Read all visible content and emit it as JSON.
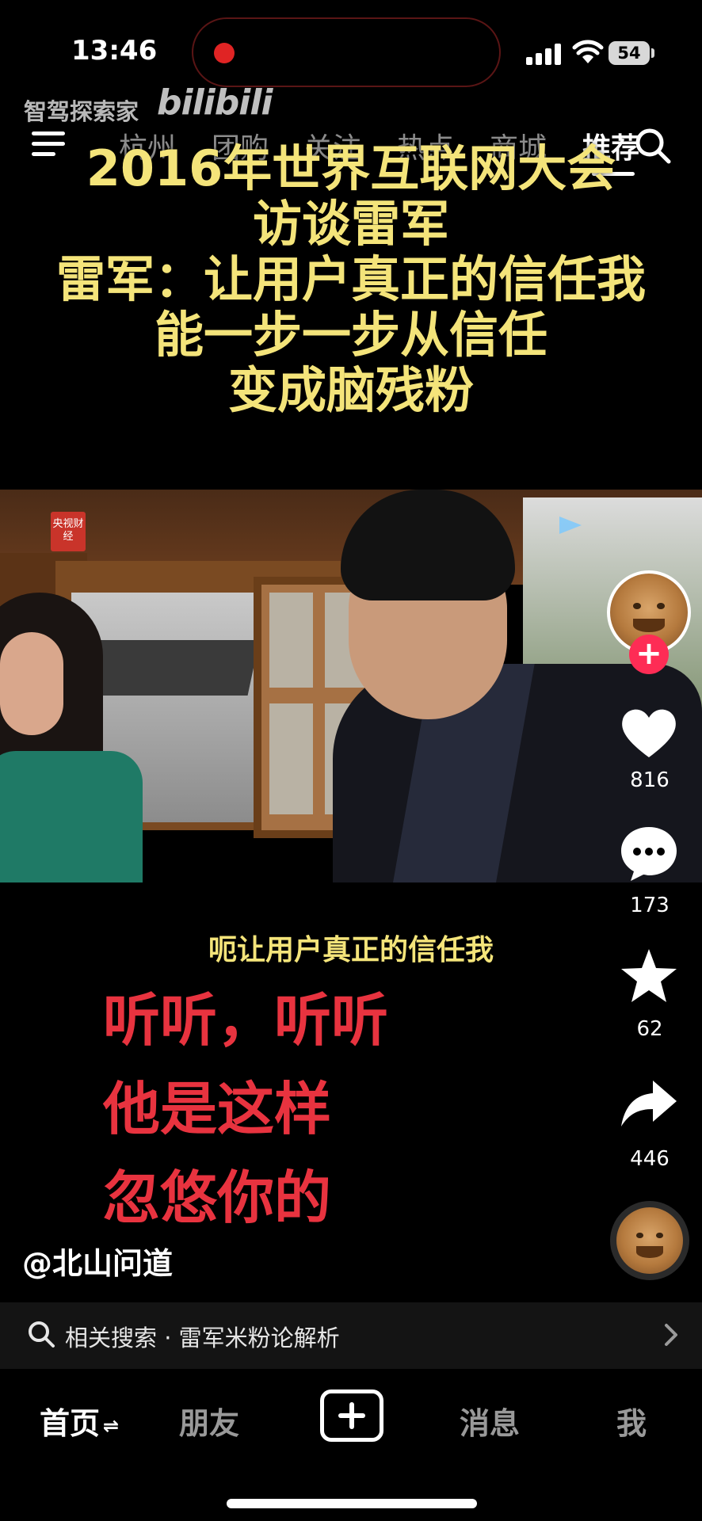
{
  "status_bar": {
    "time": "13:46",
    "battery": "54"
  },
  "watermark": {
    "channel": "智驾探索家",
    "site": "bilibili"
  },
  "top_nav": {
    "tabs": [
      {
        "label": "杭州"
      },
      {
        "label": "团购"
      },
      {
        "label": "关注"
      },
      {
        "label": "热点"
      },
      {
        "label": "商城"
      },
      {
        "label": "推荐"
      }
    ],
    "active": "推荐"
  },
  "video": {
    "headline_lines": [
      "2016年世界互联网大会",
      "访谈雷军",
      "雷军：让用户真正的信任我",
      "能一步一步从信任",
      "变成脑残粉"
    ],
    "broadcaster_logo": "央视财经",
    "caption": "呃让用户真正的信任我",
    "overlay_lines": [
      "听听，听听",
      "他是这样",
      "忽悠你的"
    ],
    "author": "@北山问道"
  },
  "actions": {
    "likes": "816",
    "comments": "173",
    "favorites": "62",
    "shares": "446"
  },
  "related_search": {
    "label": "相关搜索 · 雷军米粉论解析"
  },
  "bottom_nav": {
    "home": "首页",
    "friends": "朋友",
    "messages": "消息",
    "me": "我"
  },
  "colors": {
    "headline": "#f4e47a",
    "overlay_red": "#e8333f",
    "follow": "#fe2c55"
  }
}
